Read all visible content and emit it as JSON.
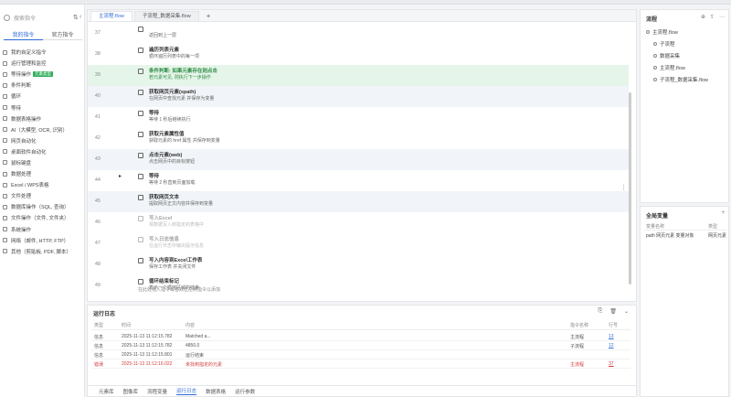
{
  "sidebar": {
    "search_placeholder": "搜索指令",
    "tabs": [
      "我的指令",
      "官方指令"
    ],
    "items": [
      {
        "label": "我的自定义指令"
      },
      {
        "label": "运行管理和监控"
      },
      {
        "label": "等待操作",
        "badge": "元素类型"
      },
      {
        "label": "条件判断"
      },
      {
        "label": "循环"
      },
      {
        "label": "等待"
      },
      {
        "label": "数据表格操作"
      },
      {
        "label": "AI（大模型, OCR, 识别）"
      },
      {
        "label": "网页自动化"
      },
      {
        "label": "桌面软件自动化"
      },
      {
        "label": "鼠标键盘"
      },
      {
        "label": "数据处理"
      },
      {
        "label": "Excel / WPS表格"
      },
      {
        "label": "文件处理"
      },
      {
        "label": "数据库操作（SQL, 查询）"
      },
      {
        "label": "文件操作（文件, 文件夹）"
      },
      {
        "label": "系统操作"
      },
      {
        "label": "网络（邮件, HTTP, FTP）"
      },
      {
        "label": "其他（剪贴板, PDF, 脚本）"
      }
    ]
  },
  "editor": {
    "tabs": [
      "主流程.flow",
      "子流程_数据采集.flow"
    ],
    "rows": [
      {
        "num": "37",
        "title": "",
        "desc": "返回到上一层",
        "style": "normal"
      },
      {
        "num": "38",
        "title": "遍历列表元素",
        "desc": "循环遍历列表中的每一项",
        "style": "normal"
      },
      {
        "num": "39",
        "title": "条件判断: 如果元素存在则点击",
        "desc": "若元素可见, 则执行下一步操作",
        "style": "green"
      },
      {
        "num": "40",
        "title": "获取网页元素(xpath)",
        "desc": "在网页中查找元素 并保存为变量",
        "style": "sel"
      },
      {
        "num": "41",
        "title": "等待",
        "desc": "等待 1 秒后继续执行",
        "style": "normal"
      },
      {
        "num": "42",
        "title": "获取元素属性值",
        "desc": "获取元素的 href 属性 并保存到变量",
        "style": "normal"
      },
      {
        "num": "43",
        "title": "点击元素(web)",
        "desc": "点击网页中的目标按钮",
        "style": "sel"
      },
      {
        "num": "44",
        "title": "等待",
        "desc": "等待 2 秒直到页面加载",
        "style": "normal"
      },
      {
        "num": "45",
        "title": "获取网页文本",
        "desc": "提取网页正文内容并保存到变量",
        "style": "sel"
      },
      {
        "num": "46",
        "title": "写入Excel",
        "desc": "将数据写入到指定的表格中",
        "style": "faded"
      },
      {
        "num": "47",
        "title": "写入日志信息",
        "desc": "在运行日志中输出提示信息",
        "style": "faded"
      },
      {
        "num": "48",
        "title": "写入内容到Excel工作表",
        "desc": "保存工作表 并关闭文件",
        "style": "normal"
      },
      {
        "num": "49",
        "title": "循环结束标记",
        "desc": "表示一个循环区域的结束",
        "style": "normal"
      }
    ],
    "hint": "在此处拖入指令或者双击左侧指令以添加"
  },
  "log": {
    "title": "运行日志",
    "columns": [
      "类型",
      "时间",
      "内容",
      "指令名称",
      "行号"
    ],
    "rows": [
      {
        "type": "信息",
        "time": "2025-11-13 11:12:15.782",
        "content": "Matched a...",
        "cmd": "主流程",
        "line": "13",
        "err": false
      },
      {
        "type": "信息",
        "time": "2025-11-13 11:12:15.782",
        "content": "4850.0",
        "cmd": "子流程",
        "line": "12",
        "err": false
      },
      {
        "type": "信息",
        "time": "2025-11-13 11:12:15.801",
        "content": "运行结束",
        "cmd": "",
        "line": "",
        "err": false
      },
      {
        "type": "错误",
        "time": "2025-11-13 11:12:16.022",
        "content": "未找到指定的元素",
        "cmd": "主流程",
        "line": "37",
        "err": true
      }
    ],
    "bottom_tabs": [
      "元素库",
      "图像库",
      "流程变量",
      "运行日志",
      "数据表格",
      "运行参数"
    ],
    "active_tab": "运行日志"
  },
  "right": {
    "flow_title": "流程",
    "flow_items": [
      "主流程.flow",
      "子流程",
      "数据采集",
      "主流程.flow",
      "子流程_数据采集.flow"
    ],
    "vars_title": "全局变量",
    "var_columns": [
      "变量名称",
      "类型"
    ],
    "var_rows": [
      {
        "name": "path 网页元素 变量对象",
        "type": "网页元素"
      }
    ]
  }
}
